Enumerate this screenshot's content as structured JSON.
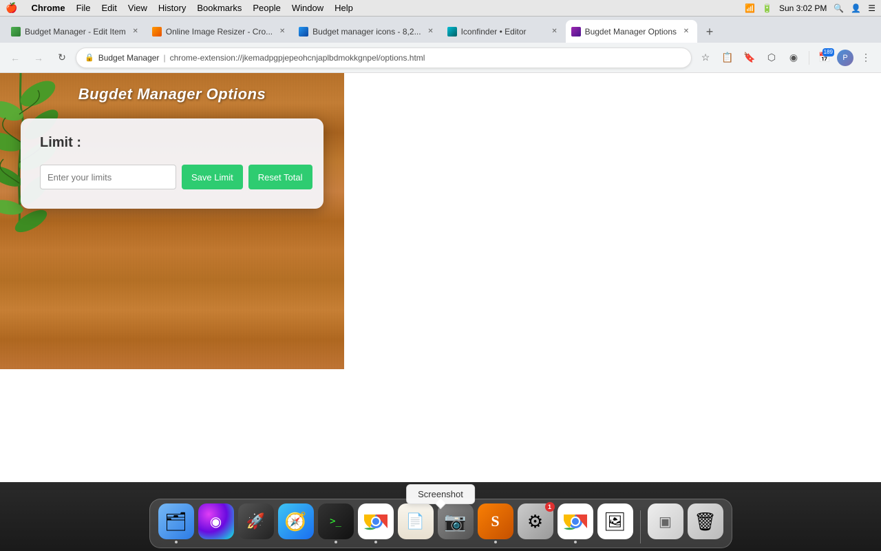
{
  "menubar": {
    "apple": "🍎",
    "items": [
      "Chrome",
      "File",
      "Edit",
      "View",
      "History",
      "Bookmarks",
      "People",
      "Window",
      "Help"
    ],
    "time": "Sun 3:02 PM"
  },
  "tabs": [
    {
      "id": "tab1",
      "title": "Budget Manager - Edit Item",
      "active": false,
      "fav_class": "fav-bm"
    },
    {
      "id": "tab2",
      "title": "Online Image Resizer - Cro...",
      "active": false,
      "fav_class": "fav-img"
    },
    {
      "id": "tab3",
      "title": "Budget manager icons - 8,2...",
      "active": false,
      "fav_class": "fav-bm2"
    },
    {
      "id": "tab4",
      "title": "Iconfinder • Editor",
      "active": false,
      "fav_class": "fav-iconfinder"
    },
    {
      "id": "tab5",
      "title": "Bugdet Manager Options",
      "active": true,
      "fav_class": "fav-bm3"
    }
  ],
  "addressbar": {
    "site": "Budget Manager",
    "separator": "|",
    "url": "chrome-extension://jkemadpgpjepeohcnjaplbdmokkgnpel/options.html",
    "lock_icon": "🔒"
  },
  "page": {
    "title": "Bugdet Manager Options",
    "card": {
      "limit_label": "Limit :",
      "input_placeholder": "Enter your limits",
      "save_button": "Save Limit",
      "reset_button": "Reset Total"
    }
  },
  "screenshot_tooltip": "Screenshot",
  "dock": {
    "items": [
      {
        "id": "finder",
        "icon": "🗂",
        "icon_class": "finder-icon",
        "has_dot": true,
        "label": "Finder"
      },
      {
        "id": "siri",
        "icon": "◉",
        "icon_class": "siri-icon",
        "has_dot": false,
        "label": "Siri"
      },
      {
        "id": "rocket",
        "icon": "🚀",
        "icon_class": "rocket-icon",
        "has_dot": false,
        "label": "Launchpad"
      },
      {
        "id": "safari",
        "icon": "🧭",
        "icon_class": "safari-icon",
        "has_dot": false,
        "label": "Safari"
      },
      {
        "id": "terminal",
        "icon": ">_",
        "icon_class": "terminal-icon",
        "has_dot": true,
        "label": "Terminal"
      },
      {
        "id": "chrome",
        "icon": "⬤",
        "icon_class": "chrome-icon",
        "has_dot": true,
        "label": "Chrome"
      },
      {
        "id": "notepad",
        "icon": "📄",
        "icon_class": "notepad-icon",
        "has_dot": false,
        "label": "Notepad"
      },
      {
        "id": "screenshot",
        "icon": "📷",
        "icon_class": "screenshot-icon",
        "has_dot": false,
        "label": "Screenshot",
        "badge": ""
      },
      {
        "id": "sublime",
        "icon": "S",
        "icon_class": "sublime-icon",
        "has_dot": true,
        "label": "Sublime Text"
      },
      {
        "id": "preferences",
        "icon": "⚙",
        "icon_class": "preferences-icon",
        "has_dot": false,
        "label": "System Preferences",
        "badge": "1"
      },
      {
        "id": "chrome2",
        "icon": "⬤",
        "icon_class": "chrome2-icon",
        "has_dot": true,
        "label": "Chrome"
      },
      {
        "id": "photos",
        "icon": "🖼",
        "icon_class": "photos-icon",
        "has_dot": false,
        "label": "Photos"
      },
      {
        "id": "window",
        "icon": "▣",
        "icon_class": "window-icon",
        "has_dot": false,
        "label": "Window"
      },
      {
        "id": "trash",
        "icon": "🗑",
        "icon_class": "trash-icon",
        "has_dot": false,
        "label": "Trash"
      }
    ]
  }
}
